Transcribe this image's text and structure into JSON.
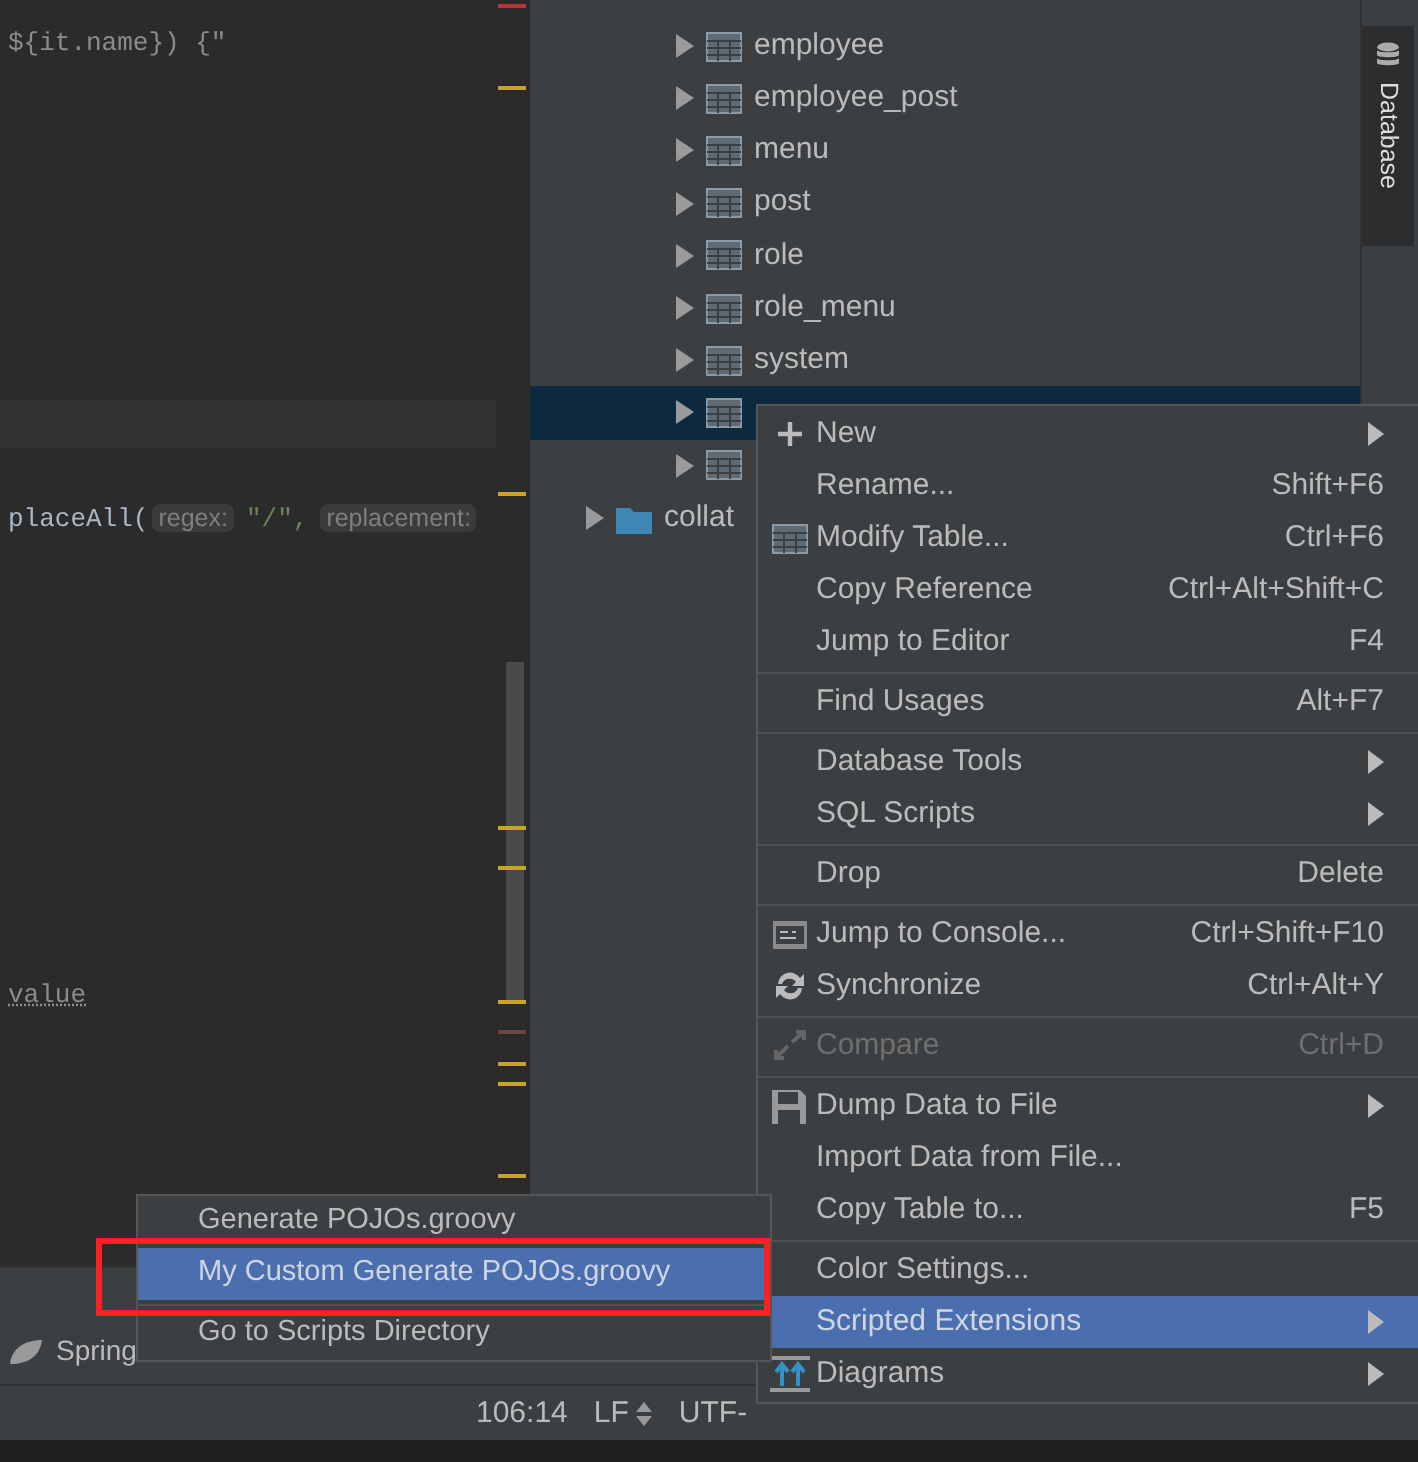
{
  "editor": {
    "current_row_visible": true,
    "lines": [
      {
        "kind": "code",
        "text": "${it.name}) {\""
      },
      {
        "kind": "call",
        "text": "placeAll(",
        "hints": [
          {
            "name": "regex:",
            "value": "\"/\","
          },
          {
            "name": "replacement:"
          }
        ]
      },
      {
        "kind": "warn",
        "text": "value"
      }
    ]
  },
  "tree": [
    {
      "children": [
        {
          "label": "employee",
          "expanded": false,
          "selected": false
        },
        {
          "label": "employee_post",
          "expanded": false,
          "selected": false
        },
        {
          "label": "menu",
          "expanded": false,
          "selected": false
        },
        {
          "label": "post",
          "expanded": false,
          "selected": false
        },
        {
          "label": "role",
          "expanded": false,
          "selected": false
        },
        {
          "label": "role_menu",
          "expanded": false,
          "selected": false
        },
        {
          "label": "system",
          "expanded": false,
          "selected": false
        },
        {
          "expanded": false,
          "selected": true
        },
        {
          "expanded": false,
          "selected": false
        }
      ]
    },
    {
      "label": "collat",
      "kind": "folder",
      "expanded": false,
      "selected": false
    }
  ],
  "side_tab": {
    "label": "Database"
  },
  "tool_windows": [
    {
      "label": "Spring"
    }
  ],
  "status_bar": [
    "106:14",
    "LF",
    "UTF-"
  ],
  "menu": {
    "groups": [
      [
        {
          "label": "New",
          "submenu": true,
          "selected": false,
          "disabled": false
        },
        {
          "label": "Rename...",
          "shortcut": "Shift+F6",
          "submenu": false,
          "selected": false,
          "disabled": false
        },
        {
          "label": "Modify Table...",
          "shortcut": "Ctrl+F6",
          "submenu": false,
          "selected": false,
          "disabled": false
        },
        {
          "label": "Copy Reference",
          "shortcut": "Ctrl+Alt+Shift+C",
          "submenu": false,
          "selected": false,
          "disabled": false
        },
        {
          "label": "Jump to Editor",
          "shortcut": "F4",
          "submenu": false,
          "selected": false,
          "disabled": false
        }
      ],
      [
        {
          "label": "Find Usages",
          "shortcut": "Alt+F7",
          "submenu": false,
          "selected": false,
          "disabled": false
        }
      ],
      [
        {
          "label": "Database Tools",
          "submenu": true,
          "selected": false,
          "disabled": false
        },
        {
          "label": "SQL Scripts",
          "submenu": true,
          "selected": false,
          "disabled": false
        }
      ],
      [
        {
          "label": "Drop",
          "shortcut": "Delete",
          "submenu": false,
          "selected": false,
          "disabled": false
        }
      ],
      [
        {
          "label": "Jump to Console...",
          "shortcut": "Ctrl+Shift+F10",
          "submenu": false,
          "selected": false,
          "disabled": false
        },
        {
          "label": "Synchronize",
          "shortcut": "Ctrl+Alt+Y",
          "submenu": false,
          "selected": false,
          "disabled": false
        }
      ],
      [
        {
          "label": "Compare",
          "shortcut": "Ctrl+D",
          "submenu": false,
          "selected": false,
          "disabled": true
        }
      ],
      [
        {
          "label": "Dump Data to File",
          "submenu": true,
          "selected": false,
          "disabled": false
        },
        {
          "label": "Import Data from File...",
          "submenu": false,
          "selected": false,
          "disabled": false
        },
        {
          "label": "Copy Table to...",
          "shortcut": "F5",
          "submenu": false,
          "selected": false,
          "disabled": false
        }
      ],
      [
        {
          "label": "Color Settings...",
          "submenu": false,
          "selected": false,
          "disabled": false
        },
        {
          "label": "Scripted Extensions",
          "submenu": true,
          "selected": true,
          "disabled": false
        },
        {
          "label": "Diagrams",
          "submenu": true,
          "selected": false,
          "disabled": false
        }
      ]
    ]
  },
  "submenu": {
    "groups": [
      [
        {
          "label": "Generate POJOs.groovy",
          "selected": false
        },
        {
          "label": "My Custom Generate POJOs.groovy",
          "selected": true
        }
      ],
      [
        {
          "label": "Go to Scripts Directory",
          "selected": false
        }
      ]
    ]
  },
  "highlight_box": true
}
